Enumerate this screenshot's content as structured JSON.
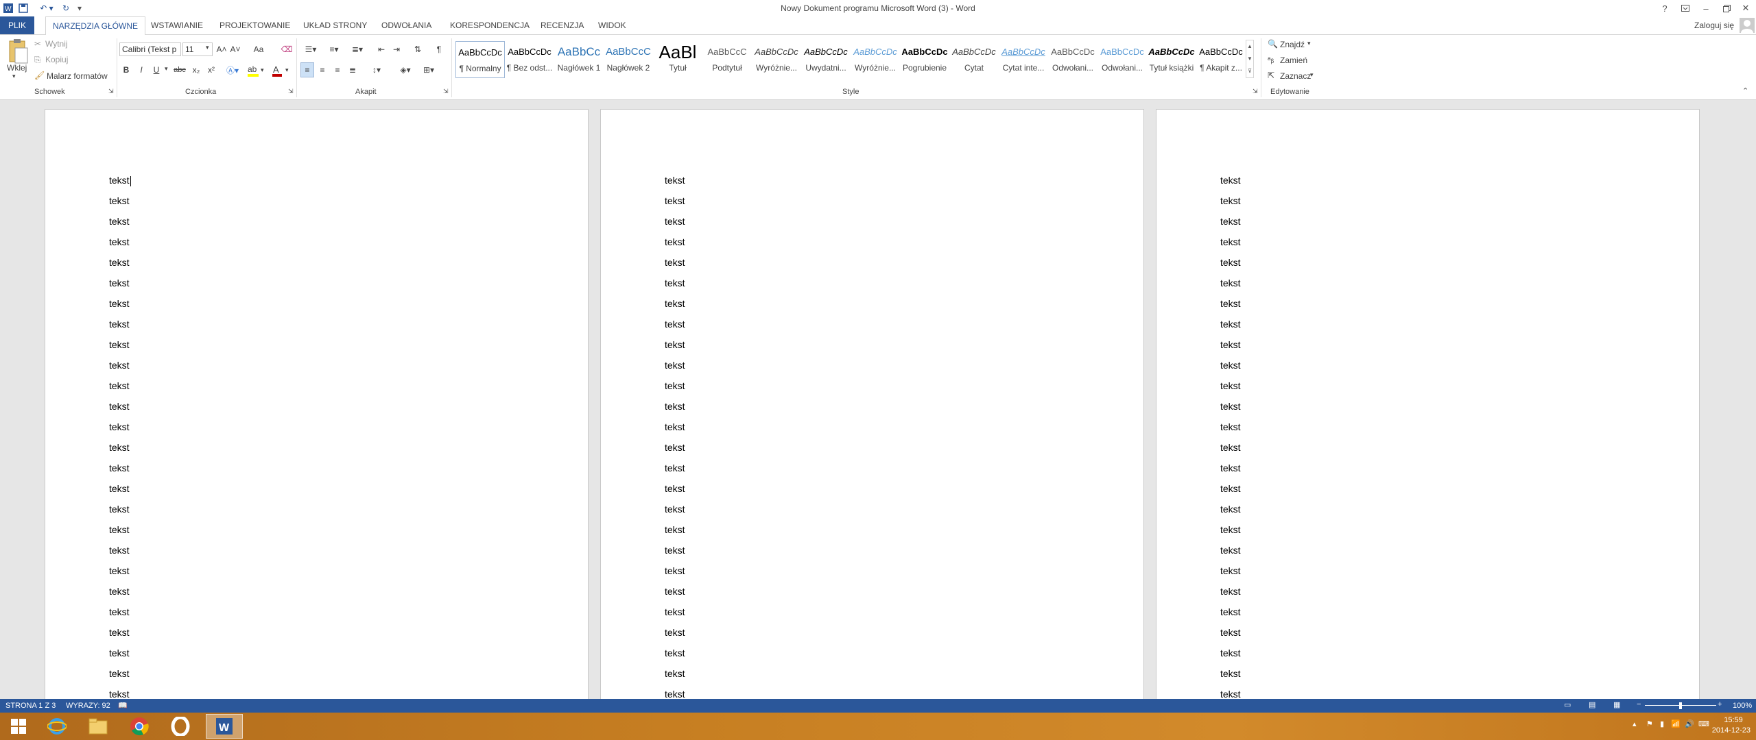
{
  "window": {
    "title": "Nowy Dokument programu Microsoft Word (3) - Word",
    "signin": "Zaloguj się",
    "help": "?"
  },
  "tabs": {
    "file": "PLIK",
    "home": "NARZĘDZIA GŁÓWNE",
    "insert": "WSTAWIANIE",
    "design": "PROJEKTOWANIE",
    "layout": "UKŁAD STRONY",
    "references": "ODWOŁANIA",
    "mailings": "KORESPONDENCJA",
    "review": "RECENZJA",
    "view": "WIDOK"
  },
  "clipboard": {
    "paste": "Wklej",
    "cut": "Wytnij",
    "copy": "Kopiuj",
    "format_painter": "Malarz formatów",
    "label": "Schowek"
  },
  "font": {
    "name": "Calibri (Tekst p",
    "size": "11",
    "label": "Czcionka",
    "grow": "A˄",
    "shrink": "A˅",
    "case": "Aa",
    "bold": "B",
    "italic": "I",
    "underline": "U",
    "strike": "abc",
    "sub": "x₂",
    "sup": "x²"
  },
  "paragraph": {
    "label": "Akapit",
    "pilcrow": "¶"
  },
  "styles": {
    "label": "Style",
    "items": [
      {
        "preview": "AaBbCcDc",
        "name": "¶ Normalny"
      },
      {
        "preview": "AaBbCcDc",
        "name": "¶ Bez odst..."
      },
      {
        "preview": "AaBbCc",
        "name": "Nagłówek 1"
      },
      {
        "preview": "AaBbCcC",
        "name": "Nagłówek 2"
      },
      {
        "preview": "AaBl",
        "name": "Tytuł"
      },
      {
        "preview": "AaBbCcC",
        "name": "Podtytuł"
      },
      {
        "preview": "AaBbCcDc",
        "name": "Wyróżnie..."
      },
      {
        "preview": "AaBbCcDc",
        "name": "Uwydatni..."
      },
      {
        "preview": "AaBbCcDc",
        "name": "Wyróżnie..."
      },
      {
        "preview": "AaBbCcDc",
        "name": "Pogrubienie"
      },
      {
        "preview": "AaBbCcDc",
        "name": "Cytat"
      },
      {
        "preview": "AaBbCcDc",
        "name": "Cytat inte..."
      },
      {
        "preview": "AaBbCcDc",
        "name": "Odwołani..."
      },
      {
        "preview": "AaBbCcDc",
        "name": "Odwołani..."
      },
      {
        "preview": "AaBbCcDc",
        "name": "Tytuł książki"
      },
      {
        "preview": "AaBbCcDc",
        "name": "¶ Akapit z..."
      }
    ]
  },
  "editing": {
    "label": "Edytowanie",
    "find": "Znajdź",
    "replace": "Zamień",
    "select": "Zaznacz"
  },
  "document": {
    "line_text": "tekst"
  },
  "status": {
    "page": "STRONA 1 Z 3",
    "words": "WYRAZY: 92",
    "zoom": "100%",
    "zoom_minus": "−",
    "zoom_plus": "+",
    "zoom_level": 0.5
  },
  "taskbar": {
    "time": "15:59",
    "date": "2014-12-23"
  },
  "colors": {
    "accent": "#2b579a",
    "font_color": "#c00000",
    "highlight": "#ffff00"
  }
}
